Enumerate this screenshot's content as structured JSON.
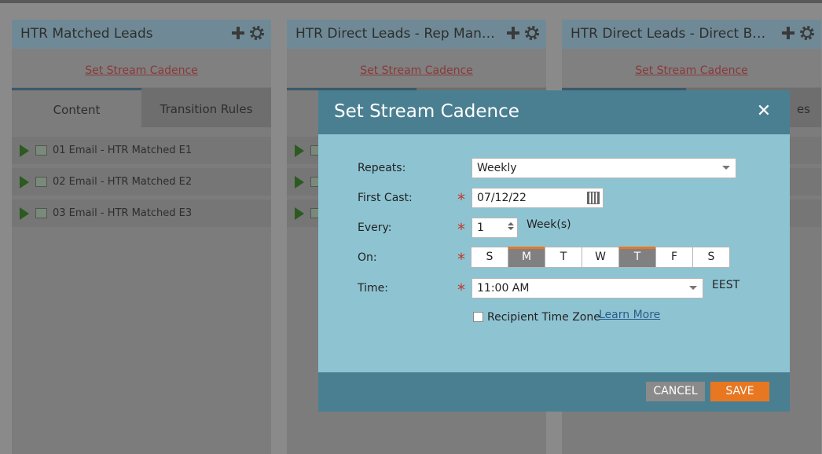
{
  "columns": [
    {
      "title": "HTR Matched Leads",
      "cadence_link": "Set Stream Cadence",
      "tabs": [
        "Content",
        "Transition Rules"
      ],
      "rows": [
        "01 Email - HTR Matched E1",
        "02 Email - HTR Matched E2",
        "03 Email - HTR Matched E3"
      ]
    },
    {
      "title": "HTR Direct Leads - Rep Mana...",
      "cadence_link": "Set Stream Cadence",
      "tabs": [
        "",
        ""
      ],
      "rows": [
        "",
        "",
        ""
      ]
    },
    {
      "title": "HTR Direct Leads - Direct Boo...",
      "cadence_link": "Set Stream Cadence",
      "tabs": [
        "",
        "es"
      ],
      "rows": []
    }
  ],
  "modal": {
    "title": "Set Stream Cadence",
    "repeats_label": "Repeats:",
    "repeats_value": "Weekly",
    "first_cast_label": "First Cast:",
    "first_cast_value": "07/12/22",
    "every_label": "Every:",
    "every_value": "1",
    "every_unit": "Week(s)",
    "on_label": "On:",
    "days": [
      "S",
      "M",
      "T",
      "W",
      "T",
      "F",
      "S"
    ],
    "selected_days": [
      1,
      4
    ],
    "time_label": "Time:",
    "time_value": "11:00 AM",
    "timezone": "EEST",
    "recipient_tz_label": "Recipient Time Zone",
    "learn_more": "Learn More",
    "cancel": "CANCEL",
    "save": "SAVE"
  },
  "colors": {
    "accent": "#e87722",
    "header": "#4a7f91",
    "body": "#8ec4d2"
  }
}
